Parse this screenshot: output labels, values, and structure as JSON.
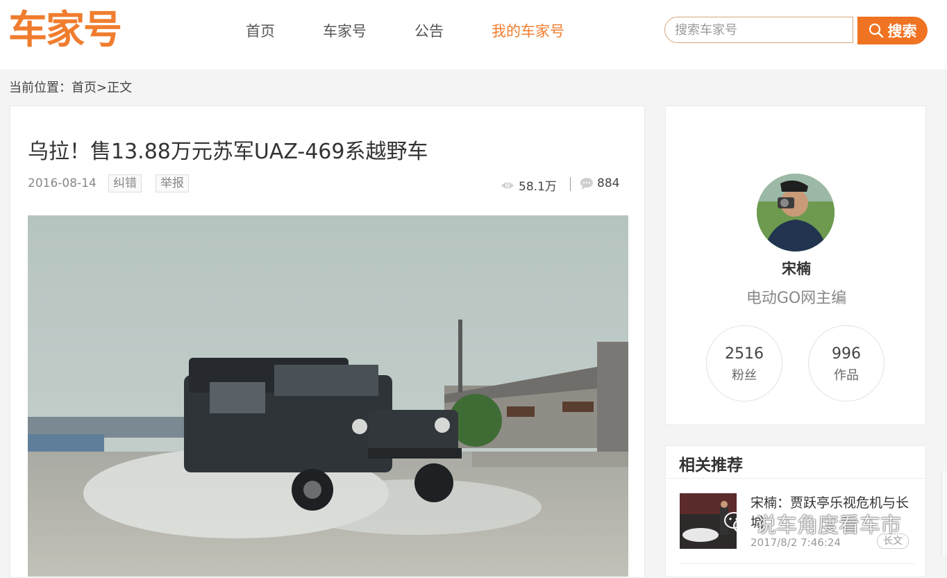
{
  "header": {
    "logo": "车家号",
    "nav": [
      "首页",
      "车家号",
      "公告",
      "我的车家号"
    ],
    "active_nav_color": "#f07d2f",
    "search_placeholder": "搜索车家号",
    "search_button": "搜索"
  },
  "breadcrumb": "当前位置：首页>正文",
  "article": {
    "title": "乌拉！售13.88万元苏军UAZ-469系越野车",
    "date": "2016-08-14",
    "tags": [
      "纠错",
      "举报"
    ],
    "views": "58.1万",
    "comments": "884",
    "image_icon": "jeep-photo"
  },
  "author": {
    "name": "宋楠",
    "title": "电动GO网主编",
    "stats": [
      {
        "value": "2516",
        "label": "粉丝"
      },
      {
        "value": "996",
        "label": "作品"
      }
    ]
  },
  "related": {
    "heading": "相关推荐",
    "items": [
      {
        "title": "宋楠：贾跃亭乐视危机与长城",
        "date": "2017/8/2 7:46:24",
        "badge": "长文"
      }
    ]
  },
  "watermark": "说车角度看车市",
  "colors": {
    "brand": "#ef7322",
    "link": "#f07d2f"
  }
}
